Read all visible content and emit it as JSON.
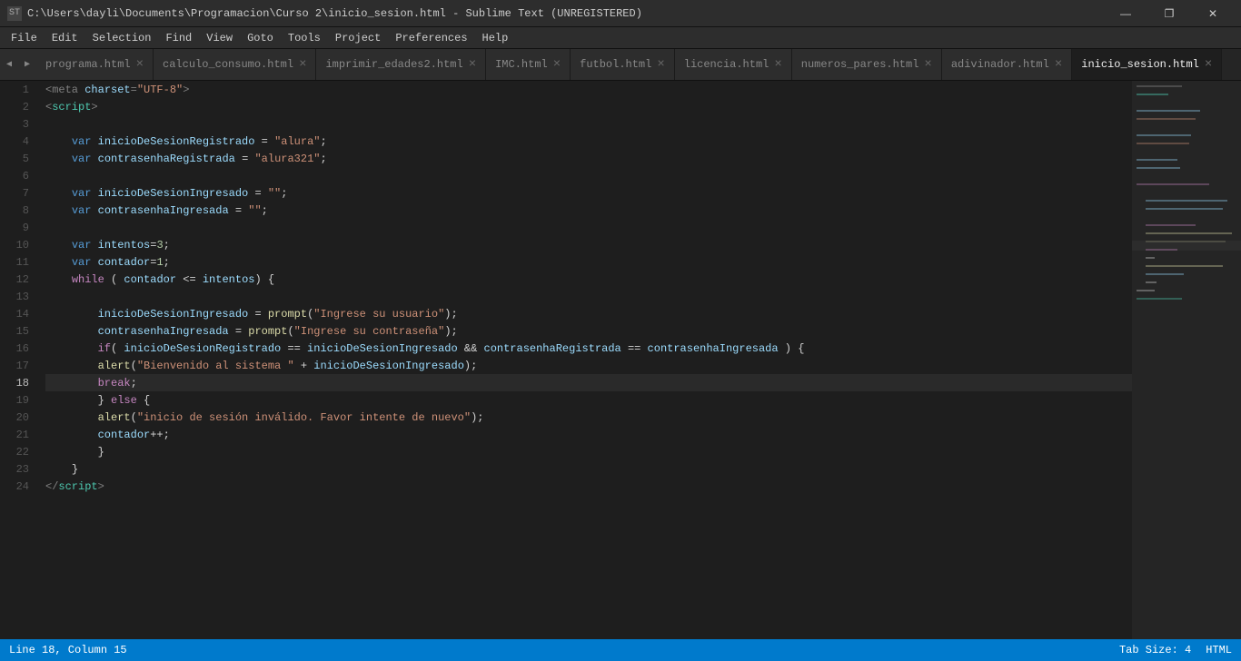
{
  "titleBar": {
    "icon": "ST",
    "title": "C:\\Users\\dayli\\Documents\\Programacion\\Curso 2\\inicio_sesion.html - Sublime Text (UNREGISTERED)",
    "minimize": "—",
    "maximize": "❐",
    "close": "✕"
  },
  "menuBar": {
    "items": [
      "File",
      "Edit",
      "Selection",
      "Find",
      "View",
      "Goto",
      "Tools",
      "Project",
      "Preferences",
      "Help"
    ]
  },
  "tabs": [
    {
      "label": "programa.html",
      "active": false
    },
    {
      "label": "calculo_consumo.html",
      "active": false
    },
    {
      "label": "imprimir_edades2.html",
      "active": false
    },
    {
      "label": "IMC.html",
      "active": false
    },
    {
      "label": "futbol.html",
      "active": false
    },
    {
      "label": "licencia.html",
      "active": false
    },
    {
      "label": "numeros_pares.html",
      "active": false
    },
    {
      "label": "adivinador.html",
      "active": false
    },
    {
      "label": "inicio_sesion.html",
      "active": true
    }
  ],
  "statusBar": {
    "line_col": "Line 18, Column 15",
    "tab_size": "Tab Size: 4",
    "language": "HTML"
  }
}
